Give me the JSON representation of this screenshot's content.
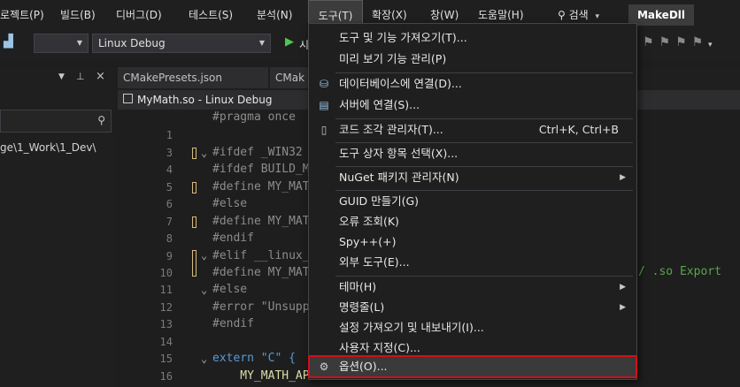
{
  "menubar": {
    "items": [
      {
        "label": "로젝트(P)"
      },
      {
        "label": "빌드(B)"
      },
      {
        "label": "디버그(D)"
      },
      {
        "label": "테스트(S)"
      },
      {
        "label": "분석(N)"
      },
      {
        "label": "도구(T)"
      },
      {
        "label": "확장(X)"
      },
      {
        "label": "창(W)"
      },
      {
        "label": "도움말(H)"
      }
    ],
    "search_label": "검색",
    "app_name": "MakeDll"
  },
  "toolbar": {
    "config_value": "Linux Debug",
    "run_label": "시"
  },
  "left_panel": {
    "path_text": "ge\\1_Work\\1_Dev\\"
  },
  "tabs": {
    "first": [
      "CMakePresets.json",
      "CMak"
    ],
    "document": "MyMath.so - Linux Debug"
  },
  "editor": {
    "lines": [
      {
        "num": "",
        "text": "#pragma once"
      },
      {
        "num": "1",
        "text": ""
      },
      {
        "num": "3",
        "text": "#ifdef _WIN32"
      },
      {
        "num": "4",
        "text": "#ifdef BUILD_M"
      },
      {
        "num": "5",
        "text": "#define MY_MAT"
      },
      {
        "num": "6",
        "text": "#else"
      },
      {
        "num": "7",
        "text": "#define MY_MAT"
      },
      {
        "num": "8",
        "text": "#endif"
      },
      {
        "num": "9",
        "text": "#elif __linux_"
      },
      {
        "num": "10",
        "text": "#define MY_MAT"
      },
      {
        "num": "11",
        "text": "#else"
      },
      {
        "num": "12",
        "text": "#error \"Unsupp"
      },
      {
        "num": "13",
        "text": "#endif"
      },
      {
        "num": "14",
        "text": ""
      },
      {
        "num": "15",
        "text": "extern \"C\" {"
      },
      {
        "num": "16",
        "text": "    MY_MATH_AP"
      }
    ],
    "comment_right": "/ .so Export"
  },
  "tools_menu": {
    "items": [
      {
        "label": "도구 및 기능 가져오기(T)...",
        "shortcut": "",
        "submenu": false,
        "icon": ""
      },
      {
        "label": "미리 보기 기능 관리(P)",
        "shortcut": "",
        "submenu": false,
        "icon": ""
      },
      {
        "label": "데이터베이스에 연결(D)...",
        "shortcut": "",
        "submenu": false,
        "icon": "database-connect-icon"
      },
      {
        "label": "서버에 연결(S)...",
        "shortcut": "",
        "submenu": false,
        "icon": "server-connect-icon"
      },
      {
        "label": "코드 조각 관리자(T)...",
        "shortcut": "Ctrl+K, Ctrl+B",
        "submenu": false,
        "icon": "snippet-icon"
      },
      {
        "label": "도구 상자 항목 선택(X)...",
        "shortcut": "",
        "submenu": false,
        "icon": ""
      },
      {
        "label": "NuGet 패키지 관리자(N)",
        "shortcut": "",
        "submenu": true,
        "icon": ""
      },
      {
        "label": "GUID 만들기(G)",
        "shortcut": "",
        "submenu": false,
        "icon": ""
      },
      {
        "label": "오류 조회(K)",
        "shortcut": "",
        "submenu": false,
        "icon": ""
      },
      {
        "label": "Spy++(+)",
        "shortcut": "",
        "submenu": false,
        "icon": ""
      },
      {
        "label": "외부 도구(E)...",
        "shortcut": "",
        "submenu": false,
        "icon": ""
      },
      {
        "label": "테마(H)",
        "shortcut": "",
        "submenu": true,
        "icon": ""
      },
      {
        "label": "명령줄(L)",
        "shortcut": "",
        "submenu": true,
        "icon": ""
      },
      {
        "label": "설정 가져오기 및 내보내기(I)...",
        "shortcut": "",
        "submenu": false,
        "icon": ""
      },
      {
        "label": "사용자 지정(C)...",
        "shortcut": "",
        "submenu": false,
        "icon": ""
      },
      {
        "label": "옵션(O)...",
        "shortcut": "",
        "submenu": false,
        "icon": "gear-icon"
      }
    ],
    "highlighted": "옵션(O)..."
  },
  "colors": {
    "highlight_border": "#d10f18",
    "accent": "#569cd6",
    "run_green": "#4ec94e"
  }
}
